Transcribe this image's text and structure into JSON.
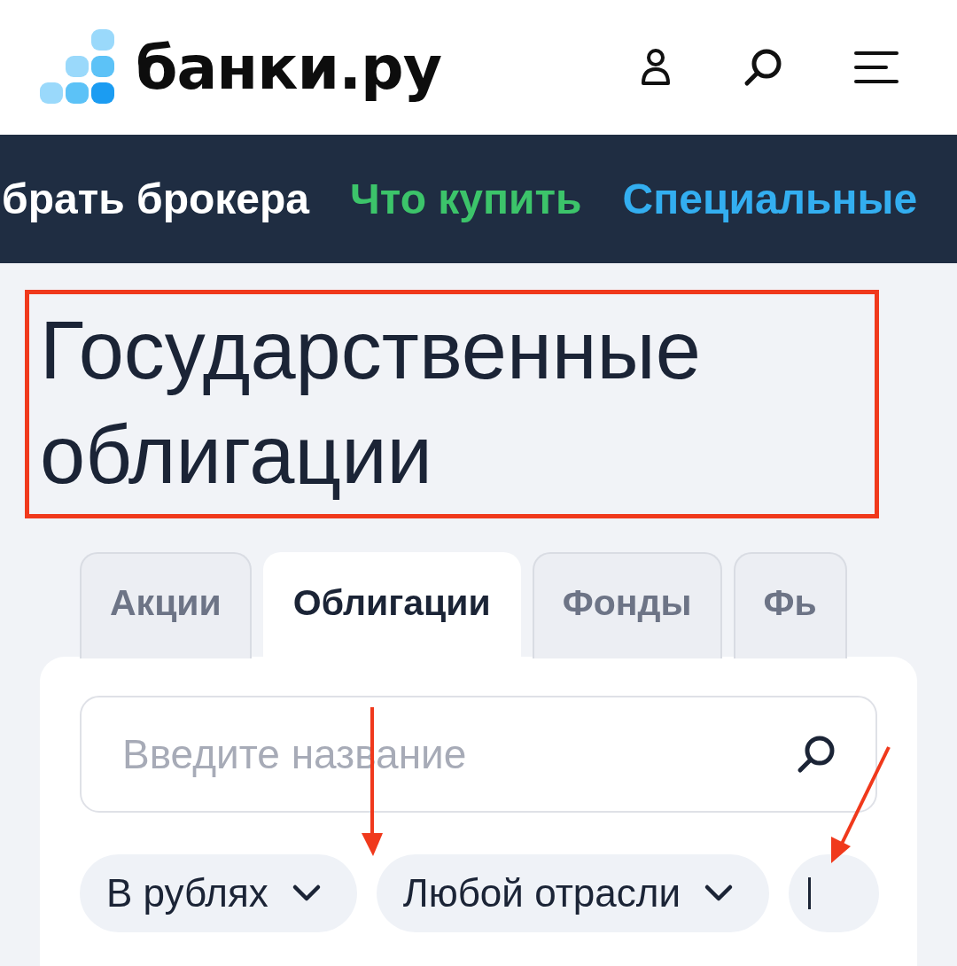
{
  "header": {
    "logo": "банки.ру"
  },
  "nav": [
    {
      "label": "брать брокера",
      "color": "#ffffff"
    },
    {
      "label": "Что купить",
      "color": "#3cc46a"
    },
    {
      "label": "Специальные",
      "color": "#33aef0"
    }
  ],
  "title": {
    "text": "Государственные облигации",
    "highlighted": true
  },
  "tabs": [
    {
      "label": "Акции",
      "selected": false
    },
    {
      "label": "Облигации",
      "selected": true
    },
    {
      "label": "Фонды",
      "selected": false
    },
    {
      "label": "Фь",
      "selected": false
    }
  ],
  "search": {
    "placeholder": "Введите название"
  },
  "filters": [
    {
      "label": "В рублях"
    },
    {
      "label": "Любой отрасли"
    }
  ]
}
